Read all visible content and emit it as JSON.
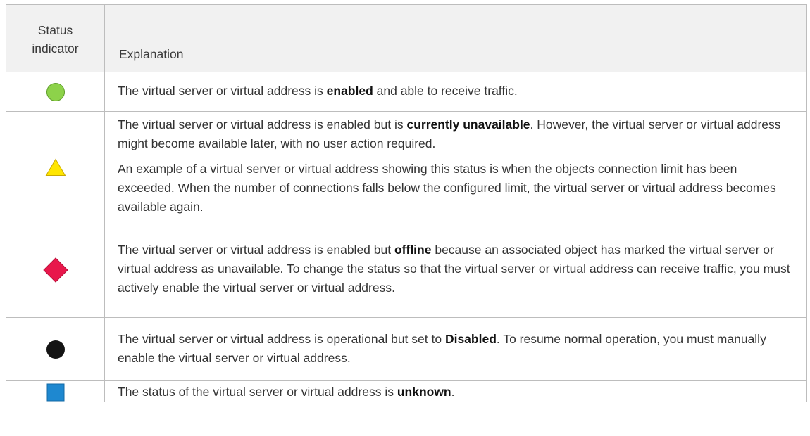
{
  "header": {
    "col1_line1": "Status",
    "col1_line2": "indicator",
    "col2": "Explanation"
  },
  "rows": [
    {
      "icon": "green-circle-icon",
      "color": "#8dd24a",
      "p1_a": "The virtual server or virtual address is ",
      "p1_b": "enabled",
      "p1_c": " and able to receive traffic."
    },
    {
      "icon": "yellow-triangle-icon",
      "color": "#ffe600",
      "p1_a": "The virtual server or virtual address is enabled but is ",
      "p1_b": "currently unavailable",
      "p1_c": ". However, the virtual server or virtual address might become available later, with no user action required.",
      "p2": "An example of a virtual server or virtual address showing this status is when the objects connection limit has been exceeded. When the number of connections falls below the configured limit, the virtual server or virtual address becomes available again."
    },
    {
      "icon": "red-diamond-icon",
      "color": "#e8174b",
      "p1_a": "The virtual server or virtual address is enabled but ",
      "p1_b": "offline",
      "p1_c": " because an associated object has marked the virtual server or virtual address as unavailable. To change the status so that the virtual server or virtual address can receive traffic, you must actively enable the virtual server or virtual address."
    },
    {
      "icon": "black-circle-icon",
      "color": "#141414",
      "p1_a": "The virtual server or virtual address is operational but set to ",
      "p1_b": "Disabled",
      "p1_c": ". To resume normal operation, you must manually enable the virtual server or virtual address."
    },
    {
      "icon": "blue-square-icon",
      "color": "#1e88d0",
      "p1_a": "The status of the virtual server or virtual address is ",
      "p1_b": "unknown",
      "p1_c": "."
    }
  ]
}
